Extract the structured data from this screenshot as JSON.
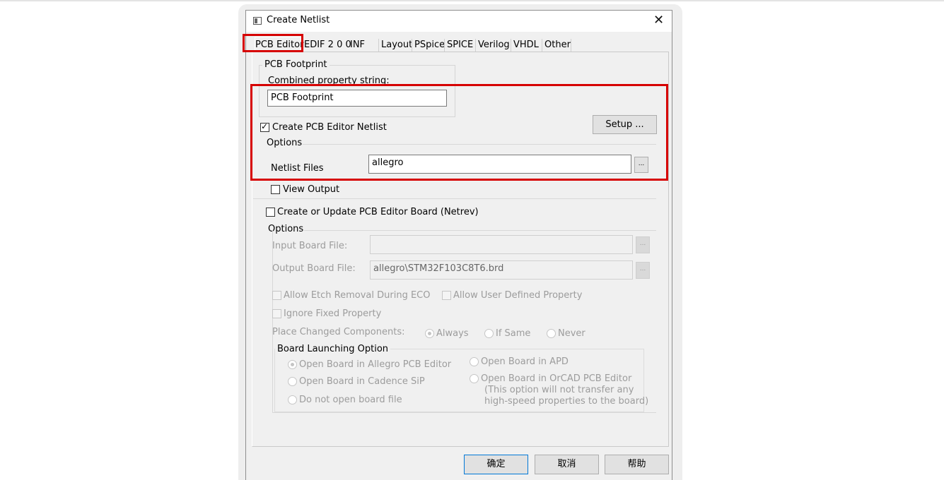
{
  "window": {
    "title": "Create Netlist",
    "close_label": "✕"
  },
  "tabs": [
    "PCB Editor",
    "EDIF 2 0 0",
    "INF",
    "Layout",
    "PSpice",
    "SPICE",
    "Verilog",
    "VHDL",
    "Other"
  ],
  "active_tab": "PCB Editor",
  "footprint": {
    "group_label": "PCB Footprint",
    "combined_label": "Combined property string:",
    "combined_value": "PCB Footprint"
  },
  "create_netlist": {
    "label": "Create PCB Editor Netlist",
    "checked": true
  },
  "setup_label": "Setup ...",
  "options1": {
    "label": "Options",
    "netlist_files_label": "Netlist Files",
    "netlist_files_value": "allegro",
    "browse_label": "...",
    "view_output_label": "View Output"
  },
  "board": {
    "create_label": "Create or Update PCB Editor Board (Netrev)",
    "options_label": "Options",
    "input_board_label": "Input Board File:",
    "input_board_value": "",
    "output_board_label": "Output Board File:",
    "output_board_value": "allegro\\STM32F103C8T6.brd",
    "browse_label": "...",
    "allow_etch_label": "Allow Etch Removal During ECO",
    "allow_user_label": "Allow User Defined Property",
    "ignore_fixed_label": "Ignore Fixed Property",
    "place_changed_label": "Place Changed Components:",
    "place_options": [
      "Always",
      "If Same",
      "Never"
    ],
    "place_selected": "Always"
  },
  "launch": {
    "label": "Board Launching Option",
    "opt_allegro": "Open Board in Allegro PCB Editor",
    "opt_sip": "Open Board in Cadence SiP",
    "opt_none": "Do not open board file",
    "opt_apd": "Open Board in APD",
    "opt_orcad": "Open Board in OrCAD PCB Editor",
    "note1": "(This option will not transfer any",
    "note2": "high-speed properties to the board)"
  },
  "buttons": {
    "ok": "确定",
    "cancel": "取消",
    "help": "帮助"
  },
  "colors": {
    "highlight": "#d60000",
    "ok_border": "#0078d7"
  }
}
